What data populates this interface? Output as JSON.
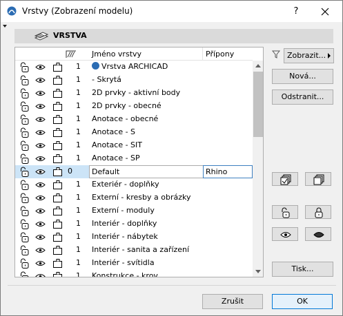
{
  "window": {
    "title": "Vrstvy (Zobrazení modelu)",
    "help_label": "?",
    "close_icon": "close-icon"
  },
  "section": {
    "title": "VRSTVA",
    "icon": "layers-icon"
  },
  "list": {
    "header": {
      "name_label": "Jméno vrstvy",
      "suffix_label": "Přípony",
      "intersection_icon": "intersection-icon",
      "sort_icon": "sort-ascending-icon"
    },
    "rows": [
      {
        "num": "1",
        "name": "Vrstva ARCHICAD",
        "suffix": "",
        "selected": false
      },
      {
        "num": "1",
        "name": "- Skrytá",
        "suffix": "",
        "selected": false
      },
      {
        "num": "1",
        "name": "2D prvky - aktivní body",
        "suffix": "",
        "selected": false
      },
      {
        "num": "1",
        "name": "2D prvky - obecné",
        "suffix": "",
        "selected": false
      },
      {
        "num": "1",
        "name": "Anotace - obecné",
        "suffix": "",
        "selected": false
      },
      {
        "num": "1",
        "name": "Anotace - S",
        "suffix": "",
        "selected": false
      },
      {
        "num": "1",
        "name": "Anotace - SIT",
        "suffix": "",
        "selected": false
      },
      {
        "num": "1",
        "name": "Anotace - SP",
        "suffix": "",
        "selected": false
      },
      {
        "num": "0",
        "name": "Default",
        "suffix": "Rhino",
        "selected": true
      },
      {
        "num": "1",
        "name": "Exteriér - doplňky",
        "suffix": "",
        "selected": false
      },
      {
        "num": "1",
        "name": "Externí - kresby a obrázky",
        "suffix": "",
        "selected": false
      },
      {
        "num": "1",
        "name": "Externí - moduly",
        "suffix": "",
        "selected": false
      },
      {
        "num": "1",
        "name": "Interiér - doplňky",
        "suffix": "",
        "selected": false
      },
      {
        "num": "1",
        "name": "Interiér - nábytek",
        "suffix": "",
        "selected": false
      },
      {
        "num": "1",
        "name": "Interiér - sanita a zařízení",
        "suffix": "",
        "selected": false
      },
      {
        "num": "1",
        "name": "Interiér - svítidla",
        "suffix": "",
        "selected": false
      },
      {
        "num": "1",
        "name": "Konstrukce - krov",
        "suffix": "",
        "selected": false
      }
    ]
  },
  "buttons": {
    "filter": "Zobrazit...",
    "new": "Nová...",
    "delete": "Odstranit...",
    "print": "Tisk...",
    "cancel": "Zrušit",
    "ok": "OK"
  },
  "icon_buttons": [
    "merge-layers-icon",
    "duplicate-layers-icon",
    "unlock-all-icon",
    "lock-all-icon",
    "show-all-icon",
    "hide-all-icon"
  ],
  "colors": {
    "selection": "#cce4f7",
    "accent": "#0078d7"
  }
}
